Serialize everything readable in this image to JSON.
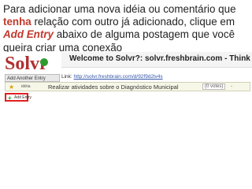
{
  "instruction": {
    "part1": "Para adicionar uma nova idéia ou comentário que ",
    "highlight1": "tenha",
    "part2": " relação com outro já adicionado, clique em ",
    "highlight2": "Add Entry",
    "part3": " abaixo de alguma postagem que você queira criar uma conexão"
  },
  "screenshot": {
    "logo": "Solvr",
    "logo_tag": "solvr",
    "add_another_entry": "Add Another Entry",
    "welcome_title": "Welcome to Solvr?: solvr.freshbrain.com - Think deeper",
    "link_label": "Link:",
    "link_url": "http://solvr.freshbrain.com/d/92f9d2lv4s",
    "entry": {
      "type_label": "idéia",
      "text": "Realizar atividades sobre o Diagnóstico Municipal",
      "votes": "(0 votes)",
      "separator": "-"
    },
    "add_entry_label": "Add Entry"
  },
  "colors": {
    "highlight": "#c0392b",
    "add_entry_border": "#e02020",
    "plus_icon": "#2f9b2f"
  }
}
